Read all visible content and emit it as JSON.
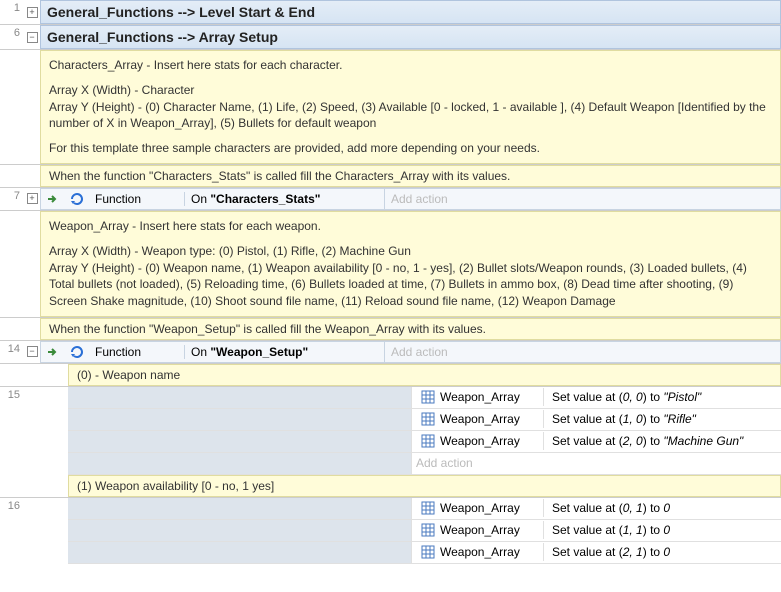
{
  "groups": {
    "g1": {
      "line": "1",
      "title": "General_Functions --> Level Start & End"
    },
    "g2": {
      "line": "6",
      "title": "General_Functions --> Array Setup"
    }
  },
  "comments": {
    "chars1": "Characters_Array - Insert here stats for each character.",
    "chars2": "Array X (Width) - Character",
    "chars3": "Array Y (Height) - (0) Character Name, (1) Life, (2) Speed, (3) Available [0 - locked, 1 - available ], (4) Default Weapon [Identified by the number of X in Weapon_Array], (5) Bullets for default weapon",
    "chars4": "For this template three sample characters are provided, add more depending on your needs.",
    "chars5": "When the function \"Characters_Stats\" is called fill the Characters_Array with its values.",
    "wep1": "Weapon_Array - Insert here stats for each weapon.",
    "wep2": "Array X (Width) - Weapon type: (0) Pistol, (1) Rifle, (2) Machine Gun",
    "wep3": "Array Y (Height) - (0) Weapon name, (1) Weapon availability [0 - no, 1 - yes], (2) Bullet slots/Weapon rounds, (3) Loaded bullets, (4) Total bullets (not loaded), (5) Reloading time, (6) Bullets loaded at time, (7) Bullets in ammo box, (8) Dead time after shooting, (9) Screen Shake magnitude, (10) Shoot sound file name, (11) Reload sound file name, (12) Weapon Damage",
    "wep4": "When the function \"Weapon_Setup\" is called fill the Weapon_Array with its values.",
    "sub0": "(0) - Weapon name",
    "sub1": "(1) Weapon availability [0 - no, 1 yes]"
  },
  "events": {
    "line7": "7",
    "line14": "14",
    "line15": "15",
    "line16": "16",
    "funcLabel": "Function",
    "on": "On ",
    "charStats": "\"Characters_Stats\"",
    "wepSetup": "\"Weapon_Setup\"",
    "addAction": "Add action",
    "arrayObj": "Weapon_Array"
  },
  "actions": {
    "a00a": "Set value at (",
    "a00b": "0, 0",
    "a00c": ") to ",
    "a00d": "\"Pistol\"",
    "a10b": "1, 0",
    "a10d": "\"Rifle\"",
    "a20b": "2, 0",
    "a20d": "\"Machine Gun\"",
    "a01b": "0, 1",
    "a01d": "0",
    "a11b": "1, 1",
    "a21b": "2, 1"
  }
}
